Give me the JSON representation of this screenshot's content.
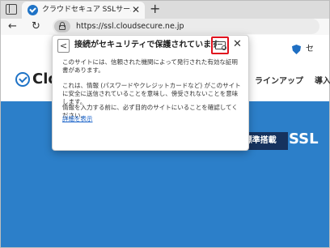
{
  "browser": {
    "tab": {
      "title": "クラウドセキュア SSLサーバー証明書",
      "favicon": "cloudsecure-check-icon",
      "close_glyph": "✕"
    },
    "new_tab_glyph": "+",
    "back_glyph": "←",
    "refresh_glyph": "↻",
    "address": {
      "url": "https://ssl.cloudsecure.ne.jp",
      "icon": "lock-icon"
    }
  },
  "page": {
    "logo_text": "Clo",
    "nav": [
      "ラインアップ",
      "導入"
    ],
    "shield_text": "セ",
    "badge": "セキュリティ診断標準搭載",
    "badge_ssl": "SSL",
    "colors": {
      "hero": "#2c7fc9",
      "badge": "#16325e",
      "brand": "#1f73c6"
    }
  },
  "popup": {
    "back_glyph": "<",
    "title": "接続がセキュリティで保護されています",
    "close_glyph": "✕",
    "paragraphs": [
      "このサイトには、信頼された機関によって発行された有効な証明書があります。",
      "これは、情報 (パスワードやクレジットカードなど) がこのサイトに安全に送信されていることを意味し、傍受されないことを意味します。",
      "情報を入力する前に、必ず目的のサイトにいることを確認してください。"
    ],
    "link": "詳細を表示",
    "highlight_color": "#e0121e"
  }
}
